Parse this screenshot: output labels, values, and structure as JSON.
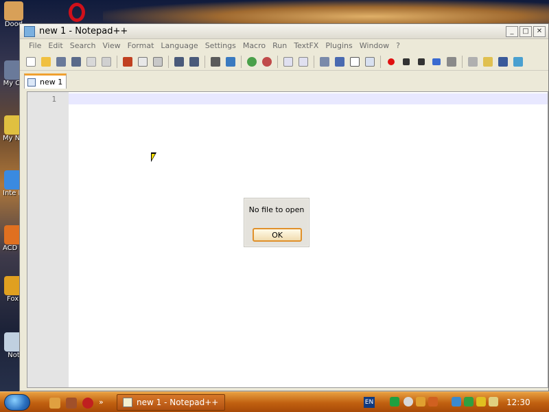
{
  "window": {
    "title": "new 1 - Notepad++",
    "buttons": {
      "minimize": "_",
      "maximize": "□",
      "close": "✕"
    }
  },
  "menubar": {
    "items": [
      "File",
      "Edit",
      "Search",
      "View",
      "Format",
      "Language",
      "Settings",
      "Macro",
      "Run",
      "TextFX",
      "Plugins",
      "Window",
      "?"
    ]
  },
  "tabs": [
    {
      "label": "new 1"
    }
  ],
  "editor": {
    "line_numbers": [
      "1"
    ]
  },
  "dialog": {
    "message": "No file to open",
    "ok_label": "OK"
  },
  "taskbar": {
    "task_label": "new 1 - Notepad++",
    "language": "EN",
    "clock": "12:30"
  },
  "desktop": {
    "icons": [
      {
        "label": "Dood"
      },
      {
        "label": "My Co"
      },
      {
        "label": "My N Fla"
      },
      {
        "label": "Inte Exp"
      },
      {
        "label": "ACD Pho"
      },
      {
        "label": "Foxi"
      },
      {
        "label": "Not"
      }
    ]
  },
  "colors": {
    "accent": "#e0902a",
    "taskbar": "#c06010",
    "tab_highlight": "#f0a030"
  }
}
